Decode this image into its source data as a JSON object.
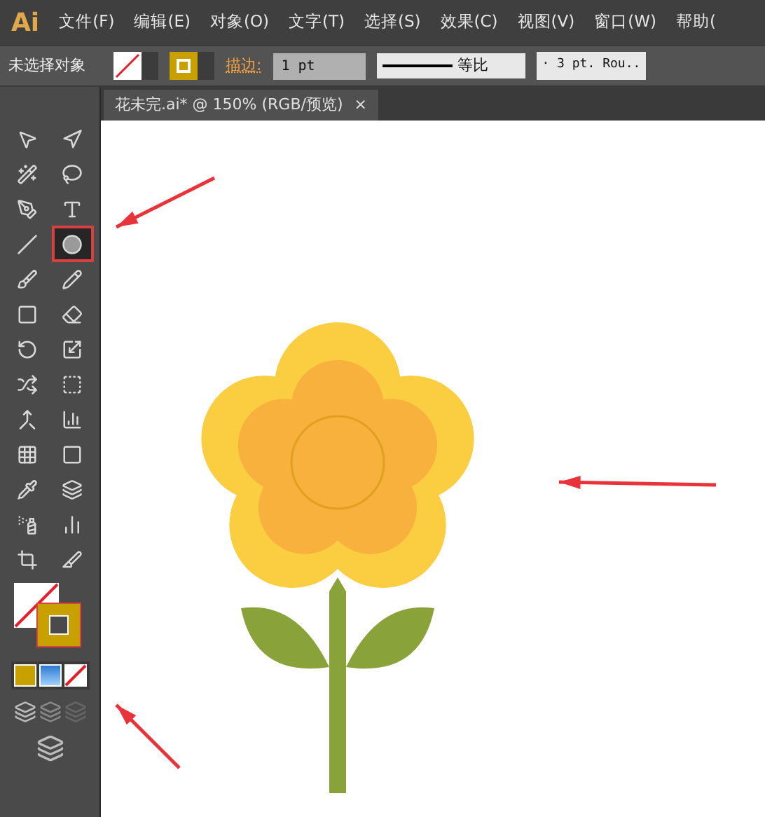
{
  "app": {
    "logo": "Ai"
  },
  "menu": [
    "文件(F)",
    "编辑(E)",
    "对象(O)",
    "文字(T)",
    "选择(S)",
    "效果(C)",
    "视图(V)",
    "窗口(W)",
    "帮助("
  ],
  "control_bar": {
    "selection": "未选择对象",
    "stroke_label": "描边:",
    "stroke_weight": "1 pt",
    "profile": "等比",
    "brush": "· 3 pt. Rou.."
  },
  "document_tab": {
    "title": "花未完.ai* @ 150% (RGB/预览)",
    "close": "×"
  },
  "tools": [
    {
      "selected": false
    },
    {
      "selected": false
    },
    {
      "selected": false
    },
    {
      "selected": false
    },
    {
      "selected": false
    },
    {
      "selected": false
    },
    {
      "selected": false
    },
    {
      "selected": true
    },
    {
      "selected": false
    },
    {
      "selected": false
    },
    {
      "selected": false
    },
    {
      "selected": false
    },
    {
      "selected": false
    },
    {
      "selected": false
    },
    {
      "selected": false
    },
    {
      "selected": false
    },
    {
      "selected": false
    },
    {
      "selected": false
    },
    {
      "selected": false
    },
    {
      "selected": false
    },
    {
      "selected": false
    },
    {
      "selected": false
    },
    {
      "selected": false
    },
    {
      "selected": false
    },
    {
      "selected": false
    },
    {
      "selected": false
    }
  ]
}
